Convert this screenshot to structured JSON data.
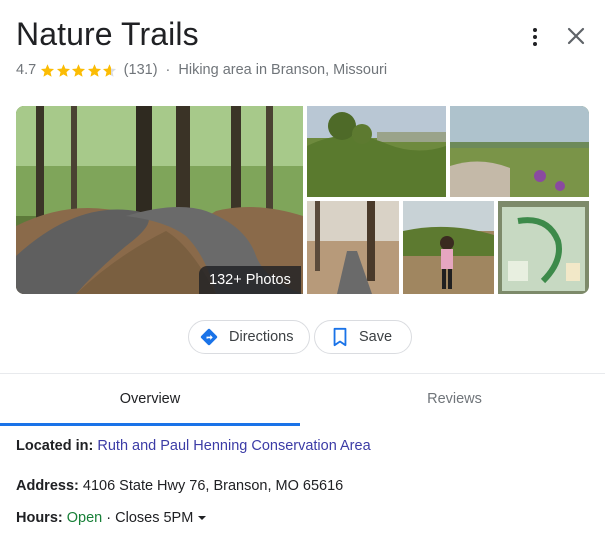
{
  "place": {
    "title": "Nature Trails",
    "rating": "4.7",
    "rating_stars": 4.7,
    "review_count": "(131)",
    "separator": "·",
    "category": "Hiking area in Branson, Missouri"
  },
  "photos": {
    "badge": "132+ Photos"
  },
  "actions": {
    "directions_label": "Directions",
    "save_label": "Save"
  },
  "tabs": {
    "overview": "Overview",
    "reviews": "Reviews"
  },
  "details": {
    "located_label": "Located in:",
    "located_value": "Ruth and Paul Henning Conservation Area",
    "address_label": "Address:",
    "address_value": "4106 State Hwy 76, Branson, MO 65616",
    "hours_label": "Hours:",
    "hours_status": "Open",
    "hours_closes": "· Closes 5PM"
  },
  "colors": {
    "star": "#fbbc04",
    "accent": "#1a73e8",
    "open": "#188038",
    "link": "#3c3ca6"
  },
  "icons": {
    "more": "more-vert-icon",
    "close": "close-icon",
    "directions": "directions-icon",
    "save": "bookmark-icon"
  }
}
